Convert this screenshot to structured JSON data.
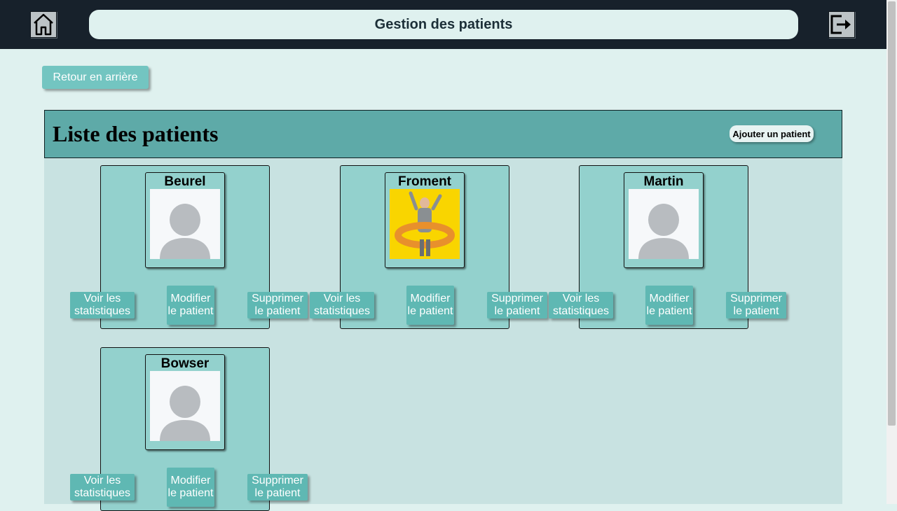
{
  "header": {
    "title": "Gestion des patients",
    "home_icon": "home-icon",
    "logout_icon": "logout-icon"
  },
  "back_button": "Retour en arrière",
  "list": {
    "title": "Liste des patients",
    "add_button": "Ajouter un patient"
  },
  "actions": {
    "stats": "Voir les statistiques",
    "edit": "Modifier le patient",
    "delete": "Supprimer le patient"
  },
  "patients": [
    {
      "name": "Beurel",
      "photo": "avatar-placeholder"
    },
    {
      "name": "Froment",
      "photo": "person-photo"
    },
    {
      "name": "Martin",
      "photo": "avatar-placeholder"
    },
    {
      "name": "Bowser",
      "photo": "avatar-placeholder"
    }
  ],
  "colors": {
    "topbar": "#17212b",
    "page_bg": "#dff1ef",
    "card_bg": "#93d1cd",
    "button_bg": "#5fb8b3",
    "list_header": "#5eaaa8"
  }
}
